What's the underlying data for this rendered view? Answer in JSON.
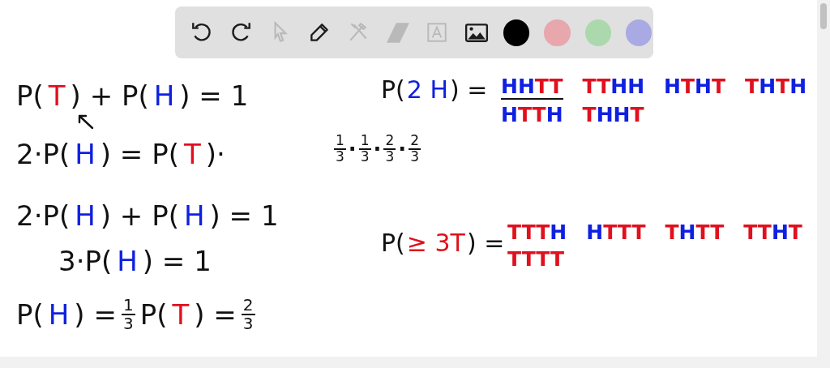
{
  "toolbar": {
    "tools": [
      {
        "kind": "undo",
        "disabled": false
      },
      {
        "kind": "redo",
        "disabled": false
      },
      {
        "kind": "select",
        "disabled": true
      },
      {
        "kind": "pen",
        "disabled": false
      },
      {
        "kind": "tools",
        "disabled": true
      },
      {
        "kind": "eraser",
        "disabled": true
      },
      {
        "kind": "text",
        "disabled": true
      },
      {
        "kind": "image",
        "disabled": false
      }
    ],
    "colors": [
      {
        "color": "#000000"
      },
      {
        "color": "#e8a6ad"
      },
      {
        "color": "#acd8ad"
      },
      {
        "color": "#a9aae4"
      }
    ]
  },
  "board": {
    "notes": [
      {
        "kind": "expression",
        "parts": [
          {
            "kind": "text",
            "text": "P(",
            "color": "#111111"
          },
          {
            "kind": "text",
            "text": "T",
            "color": "#e0101e"
          },
          {
            "kind": "text",
            "text": ") + P(",
            "color": "#111111"
          },
          {
            "kind": "text",
            "text": "H",
            "color": "#1020e0"
          },
          {
            "kind": "text",
            "text": ") = 1",
            "color": "#111111"
          }
        ]
      },
      {
        "kind": "expression",
        "parts": [
          {
            "kind": "text",
            "text": "2·P(",
            "color": "#111111"
          },
          {
            "kind": "text",
            "text": "H",
            "color": "#1020e0"
          },
          {
            "kind": "text",
            "text": ") = P(",
            "color": "#111111"
          },
          {
            "kind": "text",
            "text": "T",
            "color": "#e0101e"
          },
          {
            "kind": "text",
            "text": ")·",
            "color": "#111111"
          }
        ]
      },
      {
        "kind": "expression",
        "parts": [
          {
            "kind": "text",
            "text": "2·P(",
            "color": "#111111"
          },
          {
            "kind": "text",
            "text": "H",
            "color": "#1020e0"
          },
          {
            "kind": "text",
            "text": ") + P(",
            "color": "#111111"
          },
          {
            "kind": "text",
            "text": "H",
            "color": "#1020e0"
          },
          {
            "kind": "text",
            "text": ") = 1",
            "color": "#111111"
          }
        ]
      },
      {
        "kind": "expression",
        "parts": [
          {
            "kind": "text",
            "text": "3·P(",
            "color": "#111111"
          },
          {
            "kind": "text",
            "text": "H",
            "color": "#1020e0"
          },
          {
            "kind": "text",
            "text": ") = 1",
            "color": "#111111"
          }
        ]
      },
      {
        "kind": "expression",
        "parts": [
          {
            "kind": "text",
            "text": "P(",
            "color": "#111111"
          },
          {
            "kind": "text",
            "text": "H",
            "color": "#1020e0"
          },
          {
            "kind": "text",
            "text": ") =",
            "color": "#111111"
          },
          {
            "kind": "frac",
            "num": "1",
            "den": "3"
          },
          {
            "kind": "text",
            "text": "P(",
            "color": "#111111"
          },
          {
            "kind": "text",
            "text": "T",
            "color": "#e0101e"
          },
          {
            "kind": "text",
            "text": ") =",
            "color": "#111111"
          },
          {
            "kind": "frac",
            "num": "2",
            "den": "3"
          }
        ]
      },
      {
        "kind": "expression",
        "parts": [
          {
            "kind": "text",
            "text": "P(",
            "color": "#111111"
          },
          {
            "kind": "text",
            "text": "2 H",
            "color": "#1020e0"
          },
          {
            "kind": "text",
            "text": ") =",
            "color": "#111111"
          }
        ]
      },
      {
        "kind": "outcomes",
        "rows": [
          [
            {
              "underlined": true,
              "letters": [
                {
                  "text": "HH",
                  "color": "#1020e0"
                },
                {
                  "text": "TT",
                  "color": "#e0101e"
                }
              ]
            },
            {
              "underlined": false,
              "letters": [
                {
                  "text": "TT",
                  "color": "#e0101e"
                },
                {
                  "text": "HH",
                  "color": "#1020e0"
                }
              ]
            },
            {
              "underlined": false,
              "letters": [
                {
                  "text": "H",
                  "color": "#1020e0"
                },
                {
                  "text": "T",
                  "color": "#e0101e"
                },
                {
                  "text": "H",
                  "color": "#1020e0"
                },
                {
                  "text": "T",
                  "color": "#e0101e"
                }
              ]
            },
            {
              "underlined": false,
              "letters": [
                {
                  "text": "T",
                  "color": "#e0101e"
                },
                {
                  "text": "H",
                  "color": "#1020e0"
                },
                {
                  "text": "T",
                  "color": "#e0101e"
                },
                {
                  "text": "H",
                  "color": "#1020e0"
                }
              ]
            }
          ],
          [
            {
              "underlined": false,
              "letters": [
                {
                  "text": "H",
                  "color": "#1020e0"
                },
                {
                  "text": "TT",
                  "color": "#e0101e"
                },
                {
                  "text": "H",
                  "color": "#1020e0"
                }
              ]
            },
            {
              "underlined": false,
              "letters": [
                {
                  "text": "T",
                  "color": "#e0101e"
                },
                {
                  "text": "HH",
                  "color": "#1020e0"
                },
                {
                  "text": "T",
                  "color": "#e0101e"
                }
              ]
            }
          ]
        ]
      },
      {
        "kind": "expression",
        "parts": [
          {
            "kind": "frac",
            "num": "1",
            "den": "3"
          },
          {
            "kind": "text",
            "text": "·",
            "color": "#111111"
          },
          {
            "kind": "frac",
            "num": "1",
            "den": "3"
          },
          {
            "kind": "text",
            "text": "·",
            "color": "#111111"
          },
          {
            "kind": "frac",
            "num": "2",
            "den": "3"
          },
          {
            "kind": "text",
            "text": "·",
            "color": "#111111"
          },
          {
            "kind": "frac",
            "num": "2",
            "den": "3"
          }
        ]
      },
      {
        "kind": "expression",
        "parts": [
          {
            "kind": "text",
            "text": "P(",
            "color": "#111111"
          },
          {
            "kind": "text",
            "text": "≥ 3T",
            "color": "#e0101e"
          },
          {
            "kind": "text",
            "text": ") =",
            "color": "#111111"
          }
        ]
      },
      {
        "kind": "outcomes",
        "rows": [
          [
            {
              "underlined": false,
              "letters": [
                {
                  "text": "TTT",
                  "color": "#e0101e"
                },
                {
                  "text": "H",
                  "color": "#1020e0"
                }
              ]
            },
            {
              "underlined": false,
              "letters": [
                {
                  "text": "H",
                  "color": "#1020e0"
                },
                {
                  "text": "TTT",
                  "color": "#e0101e"
                }
              ]
            },
            {
              "underlined": false,
              "letters": [
                {
                  "text": "T",
                  "color": "#e0101e"
                },
                {
                  "text": "H",
                  "color": "#1020e0"
                },
                {
                  "text": "TT",
                  "color": "#e0101e"
                }
              ]
            },
            {
              "underlined": false,
              "letters": [
                {
                  "text": "TT",
                  "color": "#e0101e"
                },
                {
                  "text": "H",
                  "color": "#1020e0"
                },
                {
                  "text": "T",
                  "color": "#e0101e"
                }
              ]
            }
          ],
          [
            {
              "underlined": false,
              "letters": [
                {
                  "text": "TTTT",
                  "color": "#e0101e"
                }
              ]
            }
          ]
        ]
      }
    ]
  }
}
